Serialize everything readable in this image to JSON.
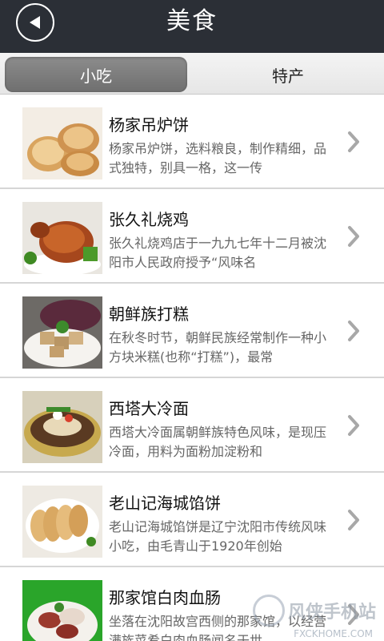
{
  "header": {
    "title": "美食",
    "back_icon": "back-arrow-icon"
  },
  "tabs": [
    {
      "label": "小吃",
      "active": true
    },
    {
      "label": "特产",
      "active": false
    }
  ],
  "items": [
    {
      "title": "杨家吊炉饼",
      "desc": "杨家吊炉饼，选料粮良，制作精细，品式独特，别具一格，这一传",
      "image": "flatbread-photo"
    },
    {
      "title": "张久礼烧鸡",
      "desc": "张久礼烧鸡店于一九九七年十二月被沈阳市人民政府授予“风味名",
      "image": "roast-chicken-photo"
    },
    {
      "title": "朝鲜族打糕",
      "desc": "在秋冬时节，朝鲜民族经常制作一种小方块米糕(也称“打糕”)，最常",
      "image": "rice-cake-photo"
    },
    {
      "title": "西塔大冷面",
      "desc": "西塔大冷面属朝鲜族特色风味，是现压冷面，用料为面粉加淀粉和",
      "image": "cold-noodle-photo"
    },
    {
      "title": "老山记海城馅饼",
      "desc": "老山记海城馅饼是辽宁沈阳市传统风味小吃，由毛青山于1920年创始",
      "image": "meat-pie-photo"
    },
    {
      "title": "那家馆白肉血肠",
      "desc": "坐落在沈阳故宫西侧的那家馆，以经营满族菜肴白肉血肠闻名于世",
      "image": "blood-sausage-photo"
    }
  ],
  "watermark": {
    "text": "风侠手机站",
    "url": "FXCKHOME.COM"
  }
}
